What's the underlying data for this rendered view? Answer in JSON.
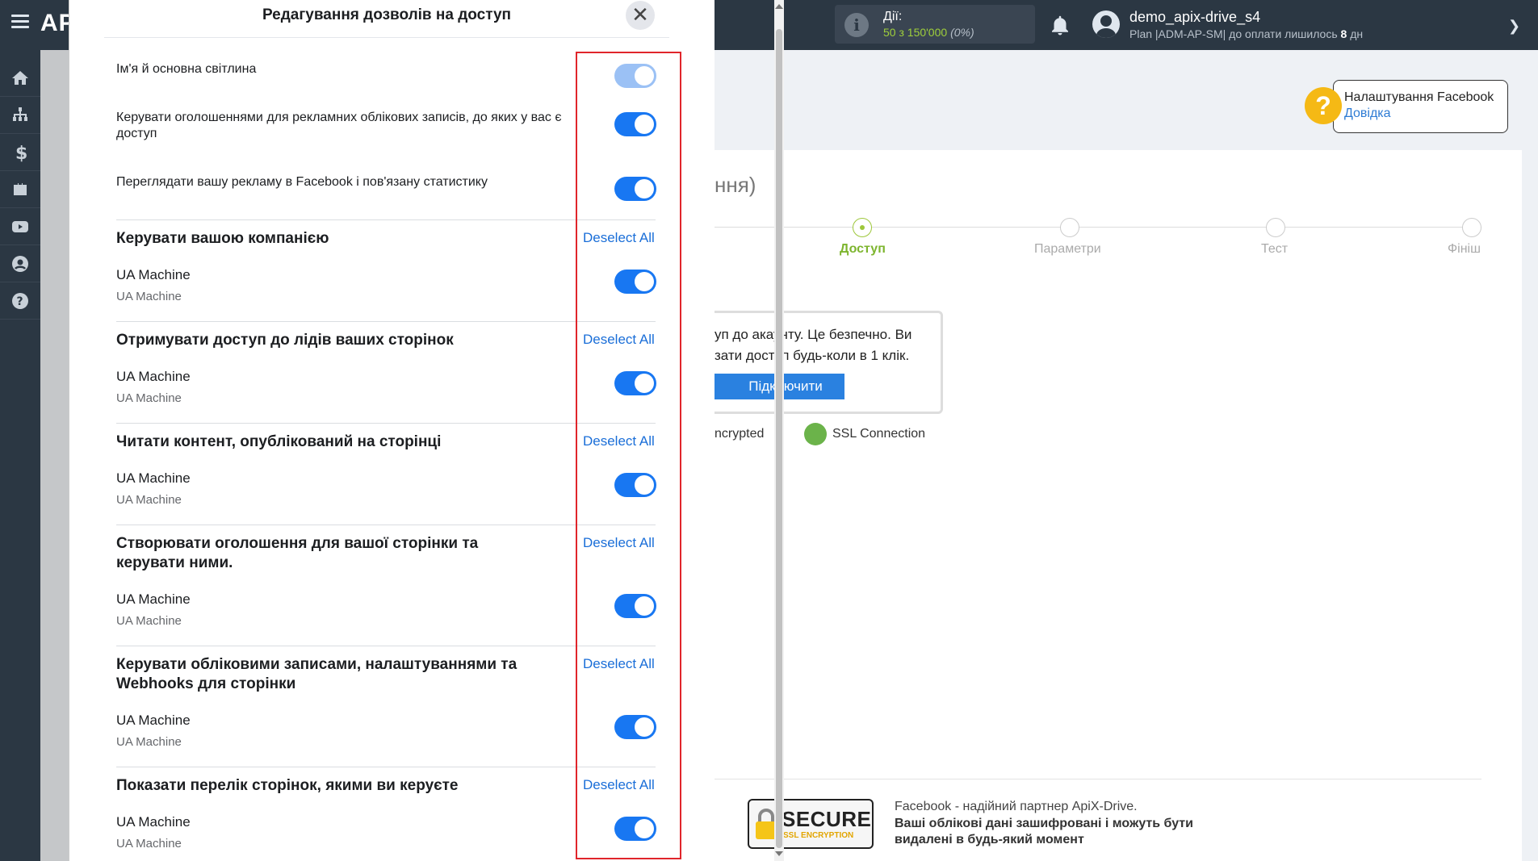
{
  "topbar": {
    "logo_prefix": "AP",
    "actions_label": "Дії:",
    "actions_used": "50",
    "actions_of": "з 150'000",
    "actions_pct": "(0%)",
    "username": "demo_apix-drive_s4",
    "plan_text": "Plan |ADM-AP-SM| до оплати лишилось",
    "plan_days": "8",
    "plan_unit": "дн"
  },
  "sidebar": {
    "items": [
      "home-icon",
      "sitemap-icon",
      "dollar-icon",
      "briefcase-icon",
      "video-icon",
      "user-icon",
      "help-icon"
    ]
  },
  "help": {
    "title": "Налаштування Facebook",
    "link": "Довідка"
  },
  "card": {
    "title_fragment": "ння)",
    "steps": [
      {
        "label": "Доступ",
        "active": true
      },
      {
        "label": "Параметри",
        "active": false
      },
      {
        "label": "Тест",
        "active": false
      },
      {
        "label": "Фініш",
        "active": false
      }
    ],
    "info_text": "уп до акаунту. Це безпечно. Ви зати доступ будь-коли в 1 клік.",
    "connect_button": "Підключити",
    "encrypted_text": "ncrypted",
    "ssl_text": "SSL Connection",
    "secure_big": "SECURE",
    "secure_small": "SSL ENCRYPTION",
    "partner_line": "Facebook - надійний партнер ApiX-Drive.",
    "partner_bold": "Ваші облікові дані зашифровані і можуть бути видалені в будь-який момент"
  },
  "modal": {
    "title": "Редагування дозволів на доступ",
    "close_symbol": "✕",
    "basic_perms": [
      {
        "label": "Ім'я й основна світлина",
        "enabled": false
      },
      {
        "label": "Керувати оголошеннями для рекламних облікових записів, до яких у вас є доступ",
        "enabled": true
      },
      {
        "label": "Переглядати вашу рекламу в Facebook і пов'язану статистику",
        "enabled": true
      }
    ],
    "deselect_label": "Deselect All",
    "sections": [
      {
        "title": "Керувати вашою компанією",
        "page_name": "UA Machine",
        "page_sub": "UA Machine"
      },
      {
        "title": "Отримувати доступ до лідів ваших сторінок",
        "page_name": "UA Machine",
        "page_sub": "UA Machine"
      },
      {
        "title": "Читати контент, опублікований на сторінці",
        "page_name": "UA Machine",
        "page_sub": "UA Machine"
      },
      {
        "title": "Створювати оголошення для вашої сторінки та керувати ними.",
        "page_name": "UA Machine",
        "page_sub": "UA Machine"
      },
      {
        "title": "Керувати обліковими записами, налаштуваннями та Webhooks для сторінки",
        "page_name": "UA Machine",
        "page_sub": "UA Machine"
      },
      {
        "title": "Показати перелік сторінок, якими ви керуєте",
        "page_name": "UA Machine",
        "page_sub": "UA Machine"
      }
    ]
  },
  "colors": {
    "toggle_on": "#1877f2",
    "highlight": "#e0252b",
    "topbar": "#2b3743"
  }
}
